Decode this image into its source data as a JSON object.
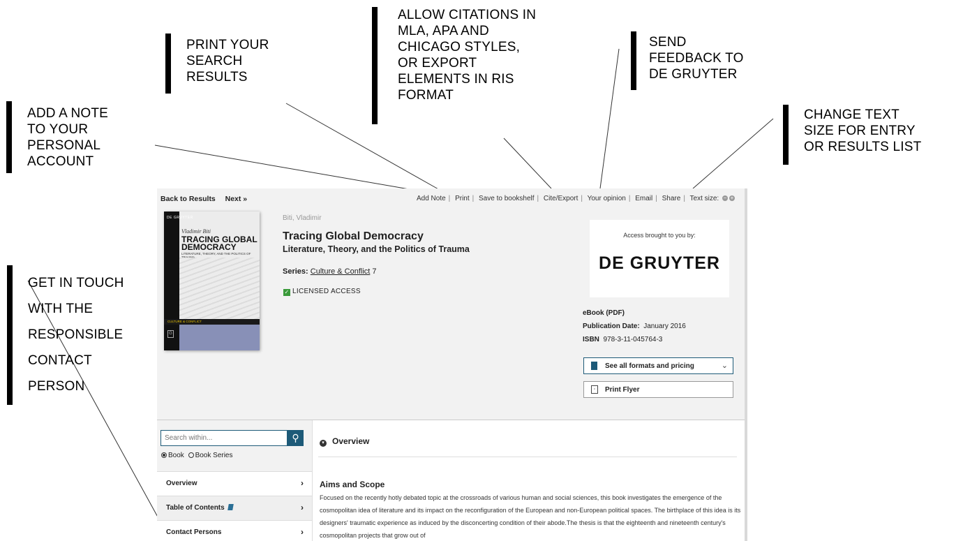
{
  "annotations": {
    "add_note": [
      "ADD A NOTE",
      "TO YOUR",
      "PERSONAL",
      "ACCOUNT"
    ],
    "print": [
      "PRINT YOUR",
      "SEARCH",
      "RESULTS"
    ],
    "cite": [
      "ALLOW CITATIONS IN",
      "MLA, APA AND",
      "CHICAGO STYLES,",
      "OR EXPORT",
      "ELEMENTS IN RIS",
      "FORMAT"
    ],
    "feedback": [
      "SEND",
      "FEEDBACK TO",
      "DE GRUYTER"
    ],
    "text_size": [
      "CHANGE TEXT",
      "SIZE FOR ENTRY",
      "OR RESULTS LIST"
    ],
    "contact": [
      "GET IN TOUCH",
      "WITH THE",
      "RESPONSIBLE",
      "CONTACT",
      "PERSON"
    ]
  },
  "nav": {
    "back": "Back to Results",
    "next": "Next »"
  },
  "toolbar": {
    "add_note": "Add Note",
    "print": "Print",
    "save": "Save to bookshelf",
    "cite": "Cite/Export",
    "opinion": "Your opinion",
    "email": "Email",
    "share": "Share",
    "text_size": "Text size:"
  },
  "cover": {
    "publisher": "DE GRUYTER",
    "author": "Vladimir Biti",
    "title_line1": "TRACING GLOBAL",
    "title_line2": "DEMOCRACY",
    "subtitle": "LITERATURE, THEORY, AND THE POLITICS OF TRAUMA",
    "series": "CULTURE & CONFLICT",
    "mark": "G"
  },
  "book": {
    "author": "Biti, Vladimir",
    "title": "Tracing Global Democracy",
    "subtitle": "Literature, Theory, and the Politics of Trauma",
    "series_label": "Series:",
    "series_name": "Culture & Conflict",
    "series_number": " 7",
    "access": "LICENSED ACCESS"
  },
  "access_box": {
    "label": "Access brought to you by:",
    "logo": "DE GRUYTER"
  },
  "details": {
    "format": "eBook (PDF)",
    "pub_label": "Publication Date:",
    "pub_value": "January 2016",
    "isbn_label": "ISBN",
    "isbn_value": "978-3-11-045764-3"
  },
  "buttons": {
    "formats": "See all formats and pricing",
    "flyer": "Print Flyer"
  },
  "search": {
    "placeholder": "Search within...",
    "option_book": "Book",
    "option_series": "Book Series"
  },
  "leftnav": [
    "Overview",
    "Table of Contents",
    "Contact Persons"
  ],
  "main": {
    "section": "Overview",
    "aims_heading": "Aims and Scope",
    "paragraph": "Focused on the recently hotly debated topic at the crossroads of various human and social sciences, this book investigates the emergence of the cosmopolitan idea of literature and its impact on the reconfiguration of the European and non-European political spaces. The birthplace of this idea is its designers' traumatic experience as induced by the disconcerting condition of their abode.The thesis is that the eighteenth and nineteenth century's cosmopolitan projects that grow out of"
  },
  "colors": {
    "accent": "#1d5a78",
    "licensed_check": "#3a9a3a",
    "cover_band": "#8890b7"
  }
}
